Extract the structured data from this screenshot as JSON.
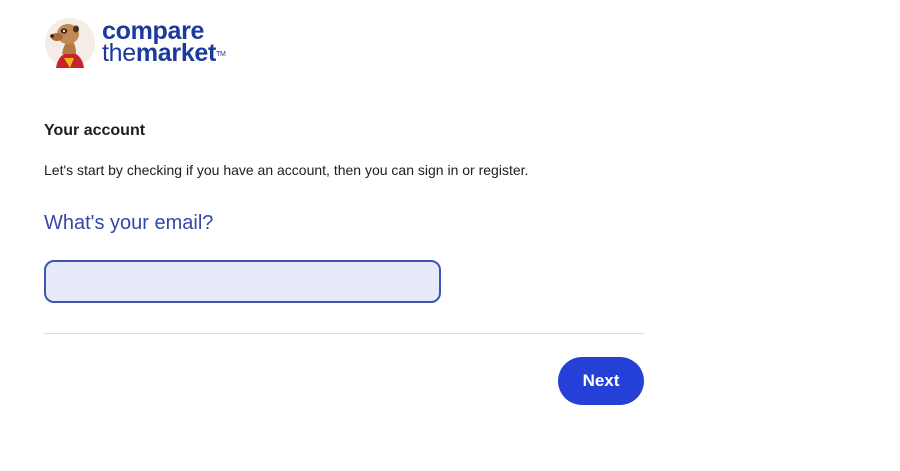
{
  "brand": {
    "line1": "compare",
    "line2_the": "the",
    "line2_market": "market",
    "trademark": "TM"
  },
  "account": {
    "title": "Your account",
    "intro": "Let's start by checking if you have an account, then you can sign in or register."
  },
  "email": {
    "question": "What's your email?",
    "value": "",
    "placeholder": ""
  },
  "actions": {
    "next_label": "Next"
  },
  "colors": {
    "brand_blue": "#1b3a9e",
    "question_blue": "#3348a8",
    "button_blue": "#2540d6",
    "input_fill": "#e8eaf9",
    "input_border": "#3f55b5"
  },
  "icons": {
    "logo": "meerkat-logo-icon"
  }
}
